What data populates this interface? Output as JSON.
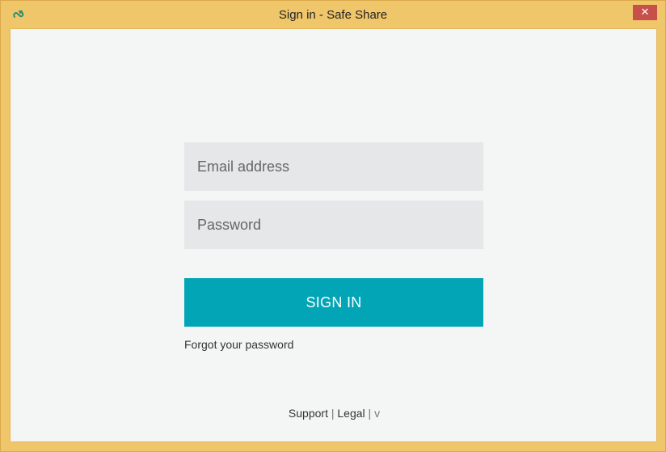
{
  "window": {
    "title": "Sign in - Safe Share",
    "close_label": "✕",
    "icon": "safe-share-logo"
  },
  "form": {
    "email_placeholder": "Email address",
    "email_value": "",
    "password_placeholder": "Password",
    "password_value": "",
    "submit_label": "SIGN IN",
    "forgot_label": "Forgot your password"
  },
  "footer": {
    "support_label": "Support",
    "separator": "|",
    "legal_label": "Legal",
    "version_label": "v"
  },
  "colors": {
    "frame": "#f0c66a",
    "content_bg": "#f4f6f6",
    "field_bg": "#e6e7e9",
    "accent": "#01a5b6",
    "close_bg": "#c7504b"
  }
}
